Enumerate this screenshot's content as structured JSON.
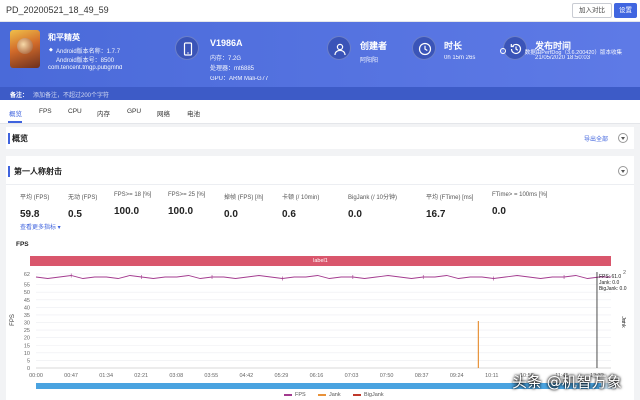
{
  "window": {
    "title": "PD_20200521_18_49_59",
    "compare_label": "加入对比",
    "settings_label": "设置"
  },
  "app": {
    "name": "和平精英",
    "android_version_name": "Android版本名称：1.7.7",
    "android_version_code": "Android版本号：8500",
    "package": "com.tencent.tmgp.pubgmhd"
  },
  "device": {
    "model": "V1986A",
    "ram": "内存：7.2G",
    "cpu": "处理器：mt6885",
    "gpu": "GPU：ARM Mali-G77"
  },
  "creator": {
    "label": "创建者",
    "value": "阿阳阳"
  },
  "duration": {
    "label": "时长",
    "value": "0h 15m 26s"
  },
  "publish": {
    "label": "发布时间",
    "value": "21/05/2020 18:50:03"
  },
  "perfdog": {
    "text": "数据由PerfDog（3.6.200420）版本收集"
  },
  "remark": {
    "label": "备注：",
    "placeholder": "添加备注，不超过200个字符"
  },
  "tabs": [
    "概览",
    "FPS",
    "CPU",
    "内存",
    "GPU",
    "网络",
    "电池"
  ],
  "overview": {
    "title": "概览",
    "export_label": "导出全部"
  },
  "section": {
    "title": "第一人称射击",
    "more_metrics": "查看更多指标",
    "metrics": [
      {
        "label": "平均 (FPS)",
        "value": "59.8"
      },
      {
        "label": "无动 (FPS)",
        "value": "0.5"
      },
      {
        "label": "FPS>= 18 [%]",
        "value": "100.0"
      },
      {
        "label": "FPS>= 25 [%]",
        "value": "100.0"
      },
      {
        "label": "掉帧 (FPS) [/h]",
        "value": "0.0"
      },
      {
        "label": "卡顿 (/ 10min)",
        "value": "0.6"
      },
      {
        "label": "BigJank (/ 10分钟)",
        "value": "0.0"
      },
      {
        "label": "平均 (FTime) [ms]",
        "value": "16.7"
      },
      {
        "label": "FTime> = 100ms [%]",
        "value": "0.0"
      }
    ]
  },
  "chart_data": {
    "type": "line",
    "title": "FPS",
    "band_label": "label1",
    "ylabel": "FPS",
    "y2label": "Jank",
    "ylim": [
      0,
      62
    ],
    "yticks": [
      0,
      5,
      10,
      15,
      20,
      25,
      30,
      35,
      40,
      45,
      50,
      55,
      62
    ],
    "y2ticks": [
      1,
      2
    ],
    "x_ticks": [
      "00:00",
      "00:47",
      "01:34",
      "02:21",
      "03:08",
      "03:55",
      "04:42",
      "05:29",
      "06:16",
      "07:03",
      "07:50",
      "08:37",
      "09:24",
      "10:11",
      "10:58",
      "11:45",
      "12:32"
    ],
    "series": [
      {
        "name": "FPS",
        "color": "#a33b8f",
        "values": [
          60,
          59,
          60,
          61,
          59,
          60,
          60,
          59,
          61,
          60,
          59,
          60,
          60,
          61,
          59,
          60,
          60,
          59,
          60,
          61,
          60,
          59,
          60,
          60,
          61,
          59,
          60,
          60,
          59,
          60,
          61,
          60,
          59,
          60,
          60,
          61,
          59,
          60,
          60,
          59,
          60,
          61,
          60,
          59,
          60,
          60,
          61,
          59,
          60,
          60
        ]
      },
      {
        "name": "Jank",
        "color": "#e8923a",
        "events": [
          {
            "x": "09:53",
            "value": 1
          }
        ]
      },
      {
        "name": "BigJank",
        "color": "#c0392b",
        "events": []
      }
    ],
    "tooltip": {
      "x": "12:32",
      "fps": "FPS: 61.0",
      "jank": "Jank: 0.0",
      "bigjank": "BigJank: 0.0"
    },
    "grid": true,
    "legend": "bottom-center"
  },
  "watermark": "头条 @机智万象"
}
